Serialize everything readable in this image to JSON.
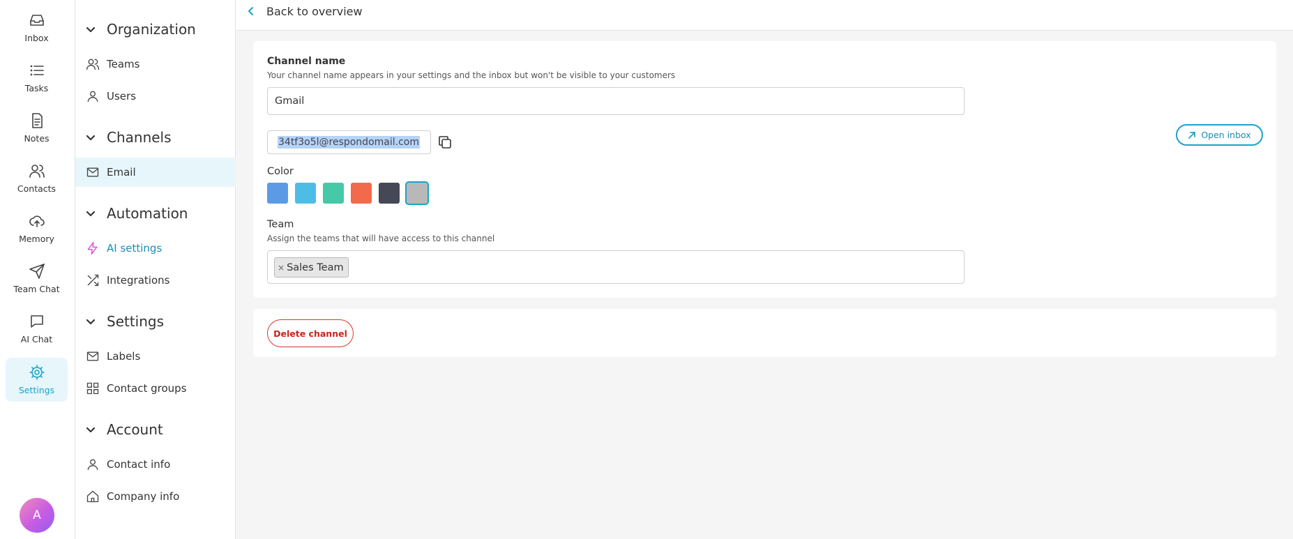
{
  "rail": {
    "items": [
      {
        "label": "Inbox",
        "icon": "inbox-icon"
      },
      {
        "label": "Tasks",
        "icon": "list-icon"
      },
      {
        "label": "Notes",
        "icon": "document-icon"
      },
      {
        "label": "Contacts",
        "icon": "users-icon"
      },
      {
        "label": "Memory",
        "icon": "cloud-upload-icon"
      },
      {
        "label": "Team Chat",
        "icon": "send-icon"
      },
      {
        "label": "AI Chat",
        "icon": "chat-bubble-icon"
      },
      {
        "label": "Settings",
        "icon": "gear-icon",
        "active": true
      }
    ],
    "avatar_initial": "A"
  },
  "sidebar": {
    "groups": [
      {
        "title": "Organization",
        "items": [
          {
            "label": "Teams",
            "icon": "users-icon"
          },
          {
            "label": "Users",
            "icon": "user-icon"
          }
        ]
      },
      {
        "title": "Channels",
        "items": [
          {
            "label": "Email",
            "icon": "mail-icon",
            "active": true
          }
        ]
      },
      {
        "title": "Automation",
        "items": [
          {
            "label": "AI settings",
            "icon": "lightning-icon"
          },
          {
            "label": "Integrations",
            "icon": "shuffle-icon"
          }
        ]
      },
      {
        "title": "Settings",
        "items": [
          {
            "label": "Labels",
            "icon": "mail-icon"
          },
          {
            "label": "Contact groups",
            "icon": "grid-icon"
          }
        ]
      },
      {
        "title": "Account",
        "items": [
          {
            "label": "Contact info",
            "icon": "user-icon"
          },
          {
            "label": "Company info",
            "icon": "home-icon"
          }
        ]
      }
    ]
  },
  "topbar": {
    "back_label": "Back to overview"
  },
  "form": {
    "channel_name_label": "Channel name",
    "channel_name_hint": "Your channel name appears in your settings and the inbox but won't be visible to your customers",
    "channel_name_value": "Gmail",
    "email_address": "34tf3o5l@respondomail.com",
    "color_label": "Color",
    "colors": [
      "#5b9be6",
      "#4dbde6",
      "#45c9a6",
      "#f3694c",
      "#454955",
      "#b8b8b8"
    ],
    "selected_color_index": 5,
    "team_label": "Team",
    "team_hint": "Assign the teams that will have access to this channel",
    "teams": [
      {
        "label": "Sales Team",
        "remove": "×"
      }
    ],
    "open_inbox_label": "Open inbox",
    "delete_label": "Delete channel"
  },
  "accent_color": "#1aa3c8",
  "danger_color": "#d9342b"
}
